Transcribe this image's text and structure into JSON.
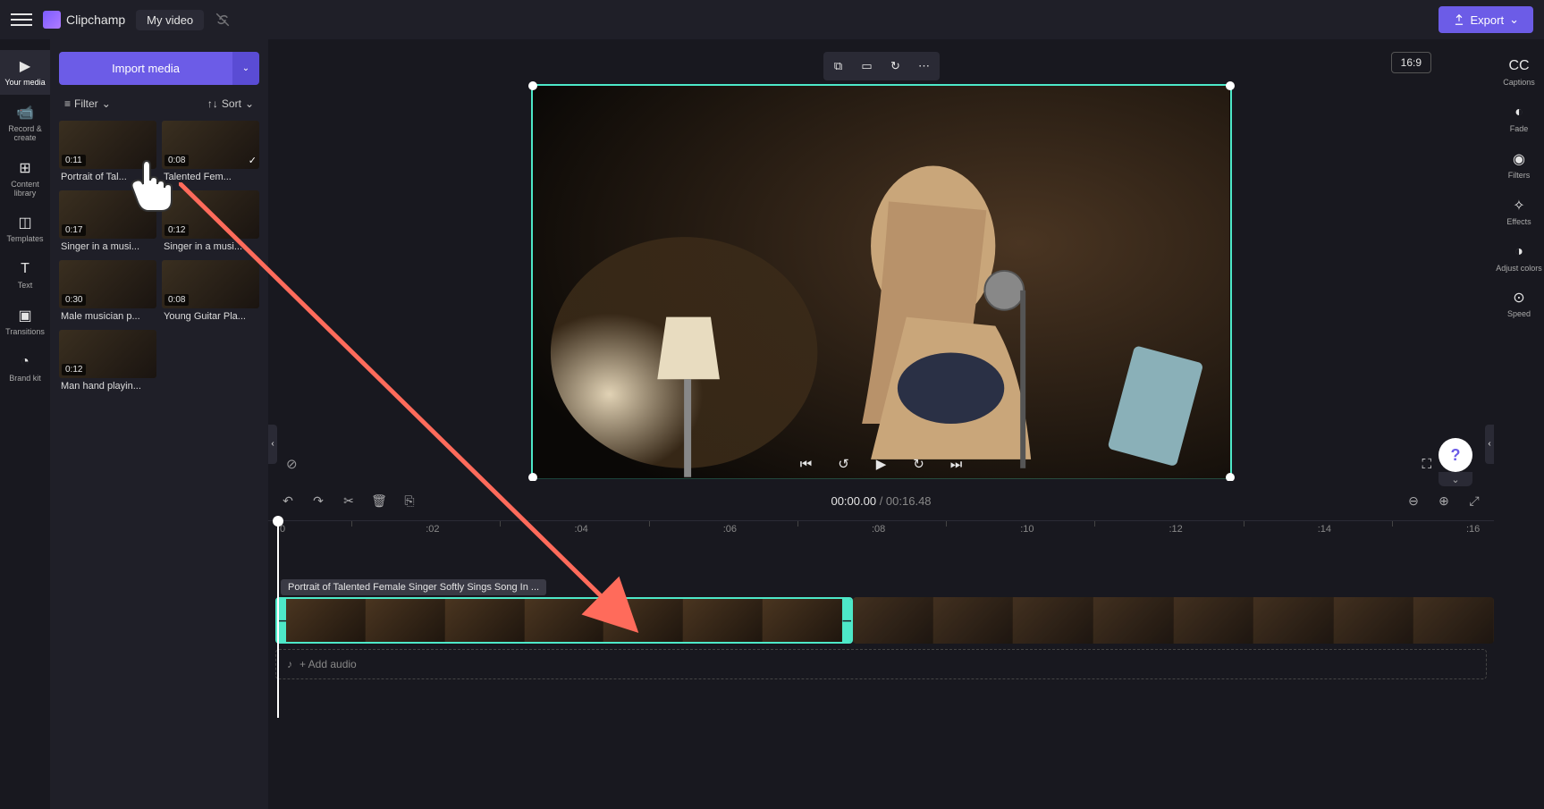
{
  "app": {
    "name": "Clipchamp",
    "project": "My video"
  },
  "topbar": {
    "export_label": "Export"
  },
  "left_rail": [
    {
      "id": "your-media",
      "label": "Your media"
    },
    {
      "id": "record-create",
      "label": "Record & create"
    },
    {
      "id": "content-library",
      "label": "Content library"
    },
    {
      "id": "templates",
      "label": "Templates"
    },
    {
      "id": "text",
      "label": "Text"
    },
    {
      "id": "transitions",
      "label": "Transitions"
    },
    {
      "id": "brand-kit",
      "label": "Brand kit"
    }
  ],
  "right_rail": [
    {
      "id": "captions",
      "label": "Captions"
    },
    {
      "id": "fade",
      "label": "Fade"
    },
    {
      "id": "filters",
      "label": "Filters"
    },
    {
      "id": "effects",
      "label": "Effects"
    },
    {
      "id": "adjust-colors",
      "label": "Adjust colors"
    },
    {
      "id": "speed",
      "label": "Speed"
    }
  ],
  "media_panel": {
    "import_label": "Import media",
    "filter_label": "Filter",
    "sort_label": "Sort",
    "items": [
      {
        "dur": "0:11",
        "name": "Portrait of Tal...",
        "used": false
      },
      {
        "dur": "0:08",
        "name": "Talented Fem...",
        "used": true
      },
      {
        "dur": "0:17",
        "name": "Singer in a musi...",
        "used": false
      },
      {
        "dur": "0:12",
        "name": "Singer in a musi...",
        "used": false
      },
      {
        "dur": "0:30",
        "name": "Male musician p...",
        "used": false
      },
      {
        "dur": "0:08",
        "name": "Young Guitar Pla...",
        "used": false
      },
      {
        "dur": "0:12",
        "name": "Man hand playin...",
        "used": false
      }
    ]
  },
  "preview": {
    "aspect_label": "16:9"
  },
  "timeline": {
    "current_time": "00:00.00",
    "duration": "00:16.48",
    "ticks": [
      ":0",
      ":02",
      ":04",
      ":06",
      ":08",
      ":10",
      ":12",
      ":14",
      ":16"
    ],
    "clip_name": "Portrait of Talented Female Singer Softly Sings Song In ...",
    "add_audio_label": "+ Add audio"
  },
  "help": {
    "label": "?"
  },
  "colors": {
    "accent": "#6c5ce7",
    "selection": "#4de8c8",
    "annotation": "#ff6b5b"
  }
}
